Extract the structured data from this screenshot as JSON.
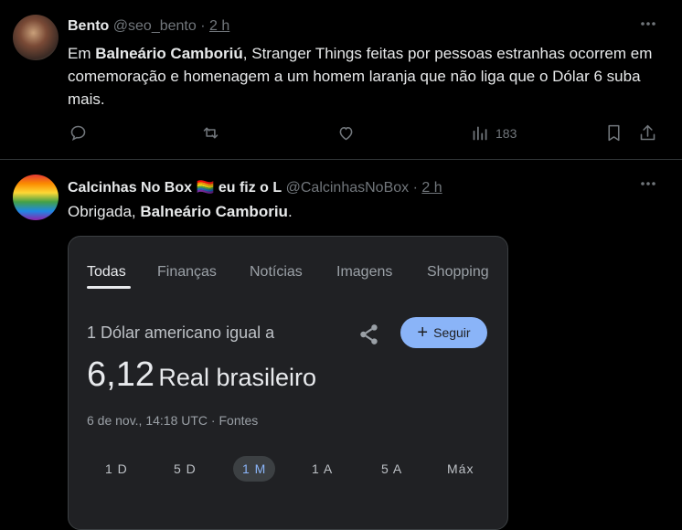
{
  "tweet1": {
    "name": "Bento",
    "handle": "@seo_bento",
    "separator": "·",
    "time": "2 h",
    "text_part1": "Em ",
    "text_bold1": "Balneário Camboriú",
    "text_part2": ", Stranger Things feitas por pessoas estranhas ocorrem em comemoração e homenagem a um homem laranja que não liga que o Dólar 6 suba mais.",
    "views": "183"
  },
  "tweet2": {
    "name": "Calcinhas No Box 🏳️‍🌈 eu fiz o L",
    "handle": "@CalcinhasNoBox",
    "separator": "·",
    "time": "2 h",
    "text_part1": "Obrigada, ",
    "text_bold1": "Balneário Camboriu",
    "text_part2": "."
  },
  "card": {
    "tabs": [
      "Todas",
      "Finanças",
      "Notícias",
      "Imagens",
      "Shopping"
    ],
    "subtitle": "1 Dólar americano igual a",
    "follow_label": "Seguir",
    "value": "6,12",
    "currency": "Real brasileiro",
    "date": "6 de nov., 14:18 UTC · Fontes",
    "ranges": [
      "1 D",
      "5 D",
      "1 M",
      "1 A",
      "5 A",
      "Máx"
    ],
    "selected_range": "1 M"
  },
  "icons": {
    "more": "more-icon",
    "reply": "reply-icon",
    "retweet": "retweet-icon",
    "like": "like-icon",
    "views": "views-icon",
    "bookmark": "bookmark-icon",
    "share": "share-icon"
  }
}
